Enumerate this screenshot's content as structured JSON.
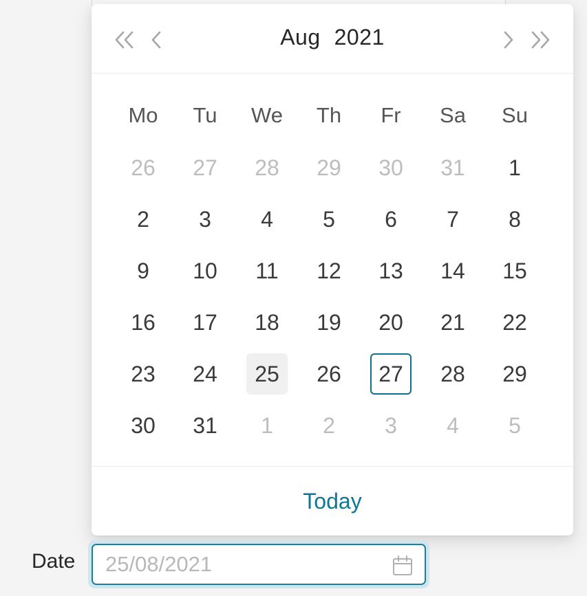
{
  "picker": {
    "month": "Aug",
    "year": "2021",
    "weekdays": [
      "Mo",
      "Tu",
      "We",
      "Th",
      "Fr",
      "Sa",
      "Su"
    ],
    "weeks": [
      [
        {
          "d": "26",
          "m": true
        },
        {
          "d": "27",
          "m": true
        },
        {
          "d": "28",
          "m": true
        },
        {
          "d": "29",
          "m": true
        },
        {
          "d": "30",
          "m": true
        },
        {
          "d": "31",
          "m": true
        },
        {
          "d": "1"
        }
      ],
      [
        {
          "d": "2"
        },
        {
          "d": "3"
        },
        {
          "d": "4"
        },
        {
          "d": "5"
        },
        {
          "d": "6"
        },
        {
          "d": "7"
        },
        {
          "d": "8"
        }
      ],
      [
        {
          "d": "9"
        },
        {
          "d": "10"
        },
        {
          "d": "11"
        },
        {
          "d": "12"
        },
        {
          "d": "13"
        },
        {
          "d": "14"
        },
        {
          "d": "15"
        }
      ],
      [
        {
          "d": "16"
        },
        {
          "d": "17"
        },
        {
          "d": "18"
        },
        {
          "d": "19"
        },
        {
          "d": "20"
        },
        {
          "d": "21"
        },
        {
          "d": "22"
        }
      ],
      [
        {
          "d": "23"
        },
        {
          "d": "24"
        },
        {
          "d": "25",
          "selected": true
        },
        {
          "d": "26"
        },
        {
          "d": "27",
          "today": true
        },
        {
          "d": "28"
        },
        {
          "d": "29"
        }
      ],
      [
        {
          "d": "30"
        },
        {
          "d": "31"
        },
        {
          "d": "1",
          "m": true
        },
        {
          "d": "2",
          "m": true
        },
        {
          "d": "3",
          "m": true
        },
        {
          "d": "4",
          "m": true
        },
        {
          "d": "5",
          "m": true
        }
      ]
    ],
    "today_label": "Today",
    "icons": {
      "super_prev": "double-chevron-left-icon",
      "prev": "chevron-left-icon",
      "next": "chevron-right-icon",
      "super_next": "double-chevron-right-icon"
    }
  },
  "field": {
    "label": "Date",
    "value": "",
    "placeholder": "25/08/2021",
    "icon": "calendar-icon"
  },
  "colors": {
    "accent": "#0e7696",
    "focus_border": "#1b7e9c",
    "focus_ring": "#cfe6ee",
    "selected_bg": "#f0f0f0",
    "muted_text": "#bdbdbd"
  }
}
